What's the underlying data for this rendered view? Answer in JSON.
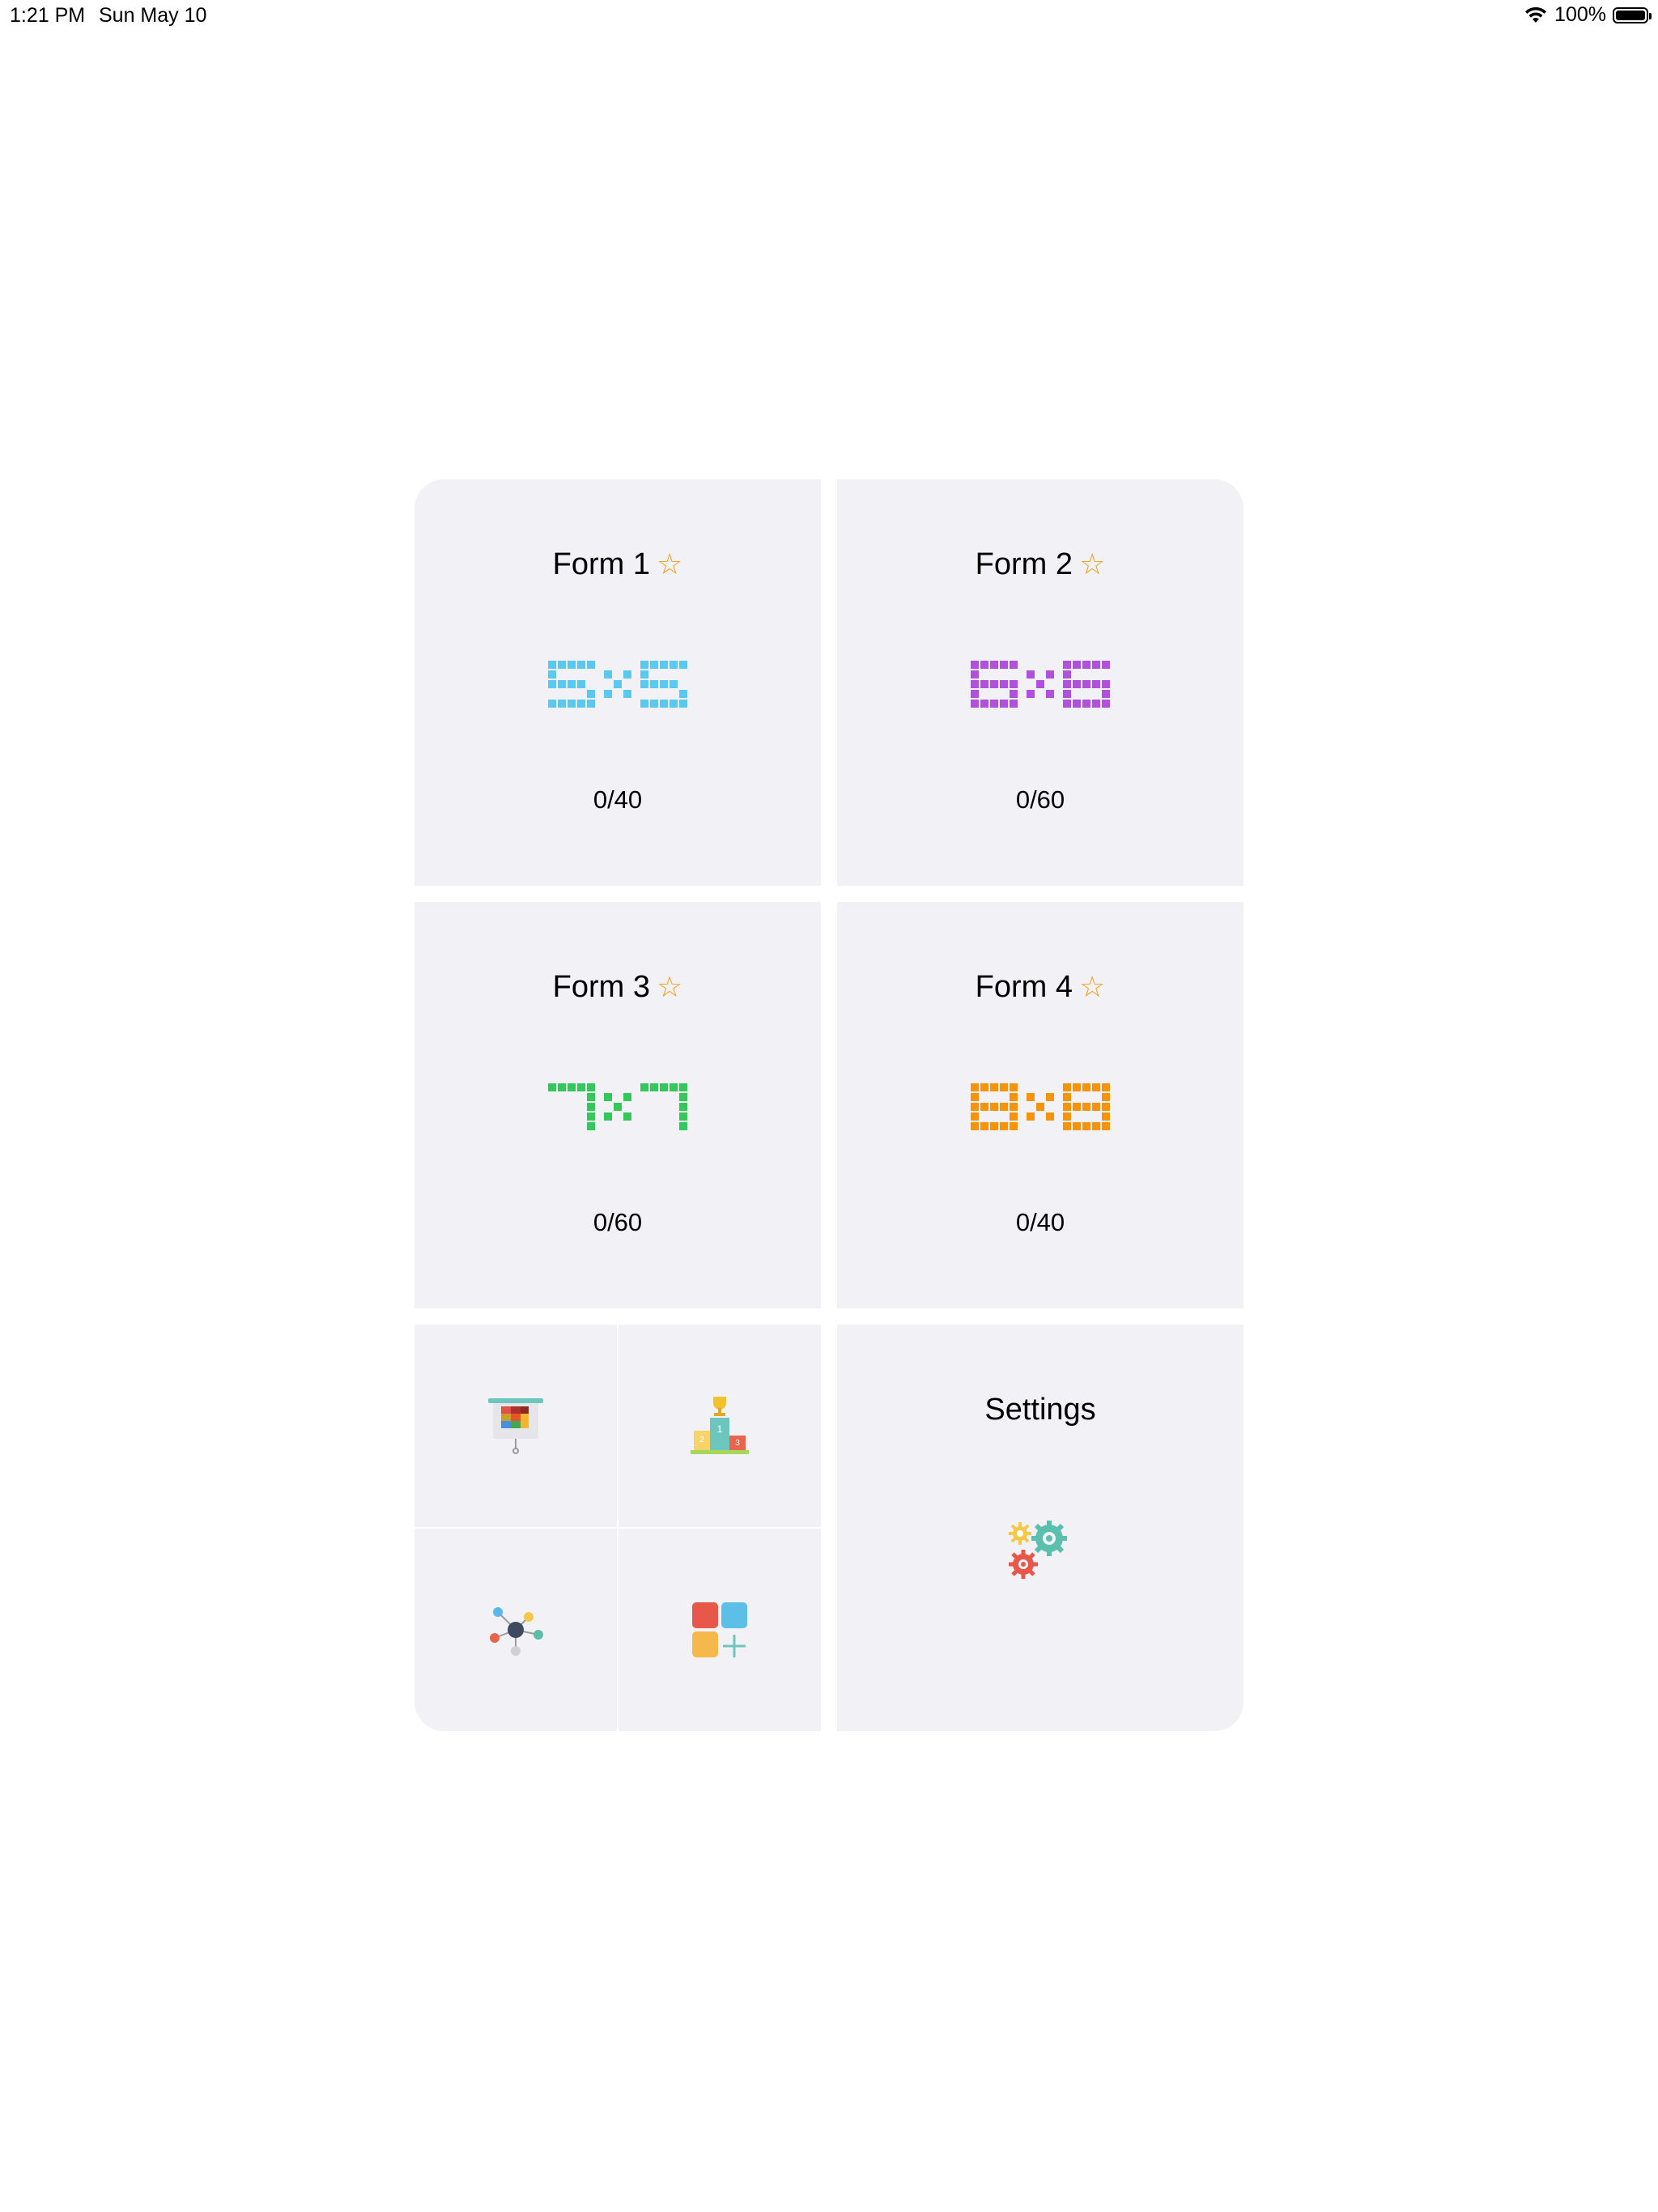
{
  "status_bar": {
    "time": "1:21 PM",
    "date": "Sun May 10",
    "battery": "100%"
  },
  "forms": [
    {
      "title": "Form 1",
      "score": "0/40",
      "glyph": "5x5",
      "color": "#5bc8f0"
    },
    {
      "title": "Form 2",
      "score": "0/60",
      "glyph": "6x6",
      "color": "#b150dc"
    },
    {
      "title": "Form 3",
      "score": "0/60",
      "glyph": "7x7",
      "color": "#34c759"
    },
    {
      "title": "Form 4",
      "score": "0/40",
      "glyph": "8x8",
      "color": "#f5930a"
    }
  ],
  "star_icon": "☆",
  "menu": {
    "items": [
      "presentation-icon",
      "podium-icon",
      "network-icon",
      "add-apps-icon"
    ]
  },
  "settings": {
    "label": "Settings",
    "icon": "gears-icon"
  }
}
